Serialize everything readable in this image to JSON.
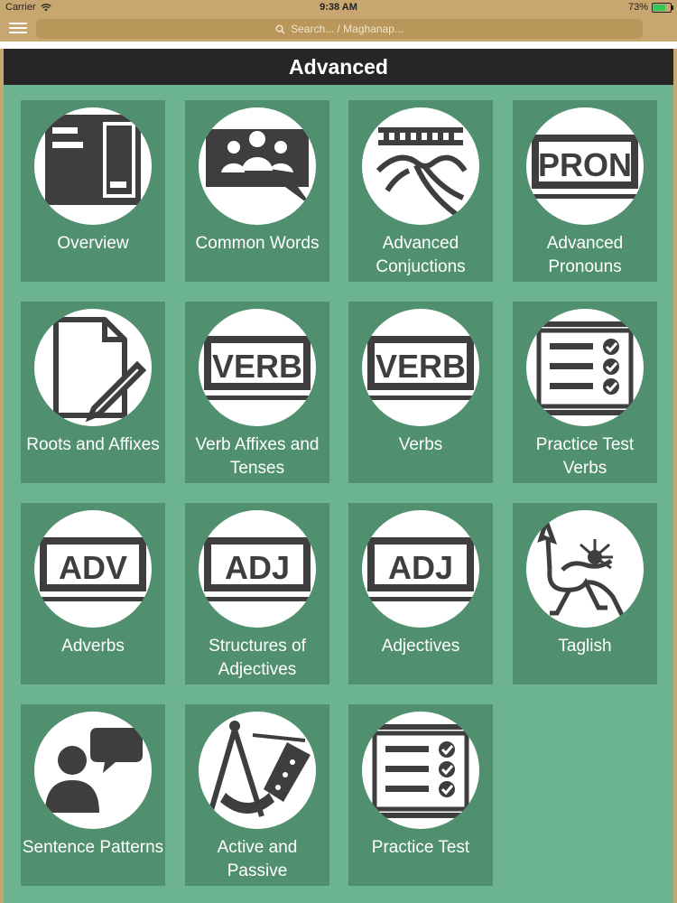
{
  "status_bar": {
    "carrier": "Carrier",
    "time": "9:38 AM",
    "battery_percent": "73%",
    "battery_level": 0.73
  },
  "nav": {
    "search_placeholder": "Search... / Maghanap..."
  },
  "page": {
    "title": "Advanced"
  },
  "tiles": [
    {
      "label": "Overview",
      "icon": "document-icon"
    },
    {
      "label": "Common Words",
      "icon": "group-chat-icon"
    },
    {
      "label": "Advanced Conjuctions",
      "icon": "bridge-icon"
    },
    {
      "label": "Advanced Pronouns",
      "icon": "pron-sign-icon",
      "badge": "PRON"
    },
    {
      "label": "Roots and Affixes",
      "icon": "page-pencil-icon"
    },
    {
      "label": "Verb Affixes and Tenses",
      "icon": "verb-sign-icon",
      "badge": "VERB"
    },
    {
      "label": "Verbs",
      "icon": "verb-sign-icon",
      "badge": "VERB"
    },
    {
      "label": "Practice Test Verbs",
      "icon": "checklist-icon"
    },
    {
      "label": "Adverbs",
      "icon": "adv-sign-icon",
      "badge": "ADV"
    },
    {
      "label": "Structures of Adjectives",
      "icon": "adj-sign-icon",
      "badge": "ADJ"
    },
    {
      "label": "Adjectives",
      "icon": "adj-sign-icon",
      "badge": "ADJ"
    },
    {
      "label": "Taglish",
      "icon": "creature-icon"
    },
    {
      "label": "Sentence Patterns",
      "icon": "person-speech-icon"
    },
    {
      "label": "Active and Passive",
      "icon": "compass-icon"
    },
    {
      "label": "Practice Test",
      "icon": "checklist-icon"
    }
  ]
}
